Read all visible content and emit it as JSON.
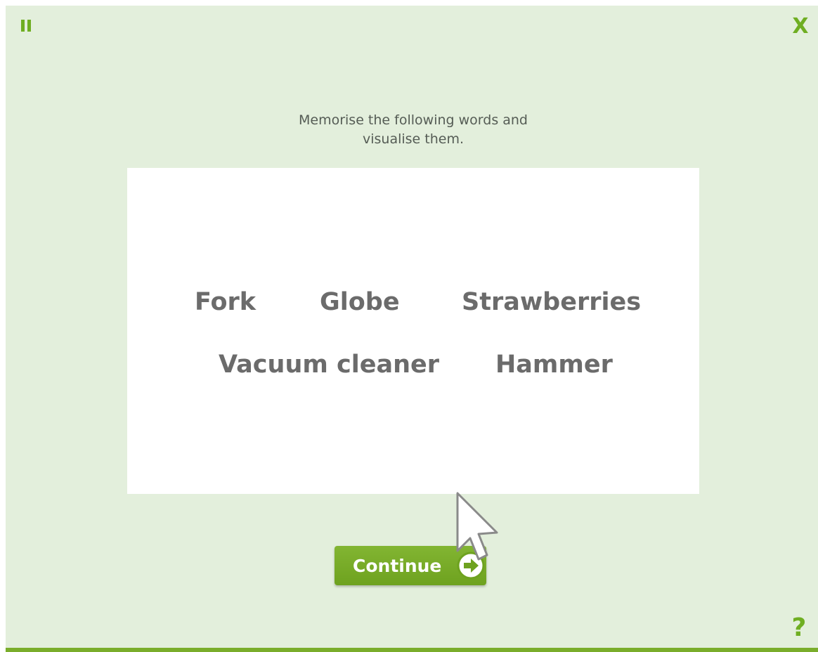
{
  "window": {
    "pause_icon": "pause-icon",
    "close_label": "X",
    "help_label": "?"
  },
  "instructions": {
    "line1": "Memorise the following words and",
    "line2": "visualise them."
  },
  "words": [
    "Fork",
    "Globe",
    "Strawberries",
    "Vacuum cleaner",
    "Hammer"
  ],
  "continue_button": {
    "label": "Continue",
    "icon": "arrow-right-circle-icon"
  },
  "colors": {
    "background": "#e3efdc",
    "accent": "#6fae22",
    "word_text": "#6b6b6b",
    "card": "#ffffff"
  }
}
